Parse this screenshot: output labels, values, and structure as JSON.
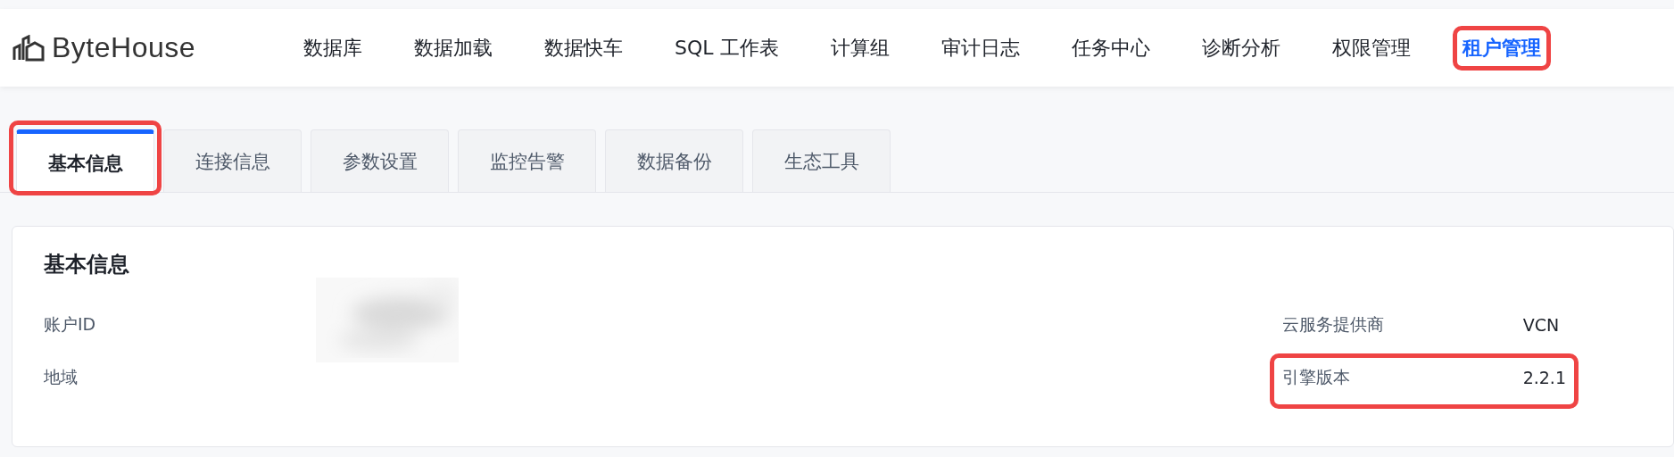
{
  "header": {
    "logo": "ByteHouse",
    "nav": [
      {
        "label": "数据库",
        "selected": false,
        "highlighted": false
      },
      {
        "label": "数据加载",
        "selected": false,
        "highlighted": false
      },
      {
        "label": "数据快车",
        "selected": false,
        "highlighted": false
      },
      {
        "label": "SQL 工作表",
        "selected": false,
        "highlighted": false
      },
      {
        "label": "计算组",
        "selected": false,
        "highlighted": false
      },
      {
        "label": "审计日志",
        "selected": false,
        "highlighted": false
      },
      {
        "label": "任务中心",
        "selected": false,
        "highlighted": false
      },
      {
        "label": "诊断分析",
        "selected": false,
        "highlighted": false
      },
      {
        "label": "权限管理",
        "selected": false,
        "highlighted": false
      },
      {
        "label": "租户管理",
        "selected": true,
        "highlighted": true
      }
    ]
  },
  "tabs": [
    {
      "label": "基本信息",
      "selected": true,
      "highlighted": true
    },
    {
      "label": "连接信息",
      "selected": false,
      "highlighted": false
    },
    {
      "label": "参数设置",
      "selected": false,
      "highlighted": false
    },
    {
      "label": "监控告警",
      "selected": false,
      "highlighted": false
    },
    {
      "label": "数据备份",
      "selected": false,
      "highlighted": false
    },
    {
      "label": "生态工具",
      "selected": false,
      "highlighted": false
    }
  ],
  "card": {
    "title": "基本信息",
    "left_fields": [
      {
        "label": "账户ID"
      },
      {
        "label": "地域"
      }
    ],
    "right_fields": [
      {
        "label": "云服务提供商",
        "value": "VCN",
        "highlighted": false
      },
      {
        "label": "引擎版本",
        "value": "2.2.1",
        "highlighted": true
      }
    ]
  }
}
